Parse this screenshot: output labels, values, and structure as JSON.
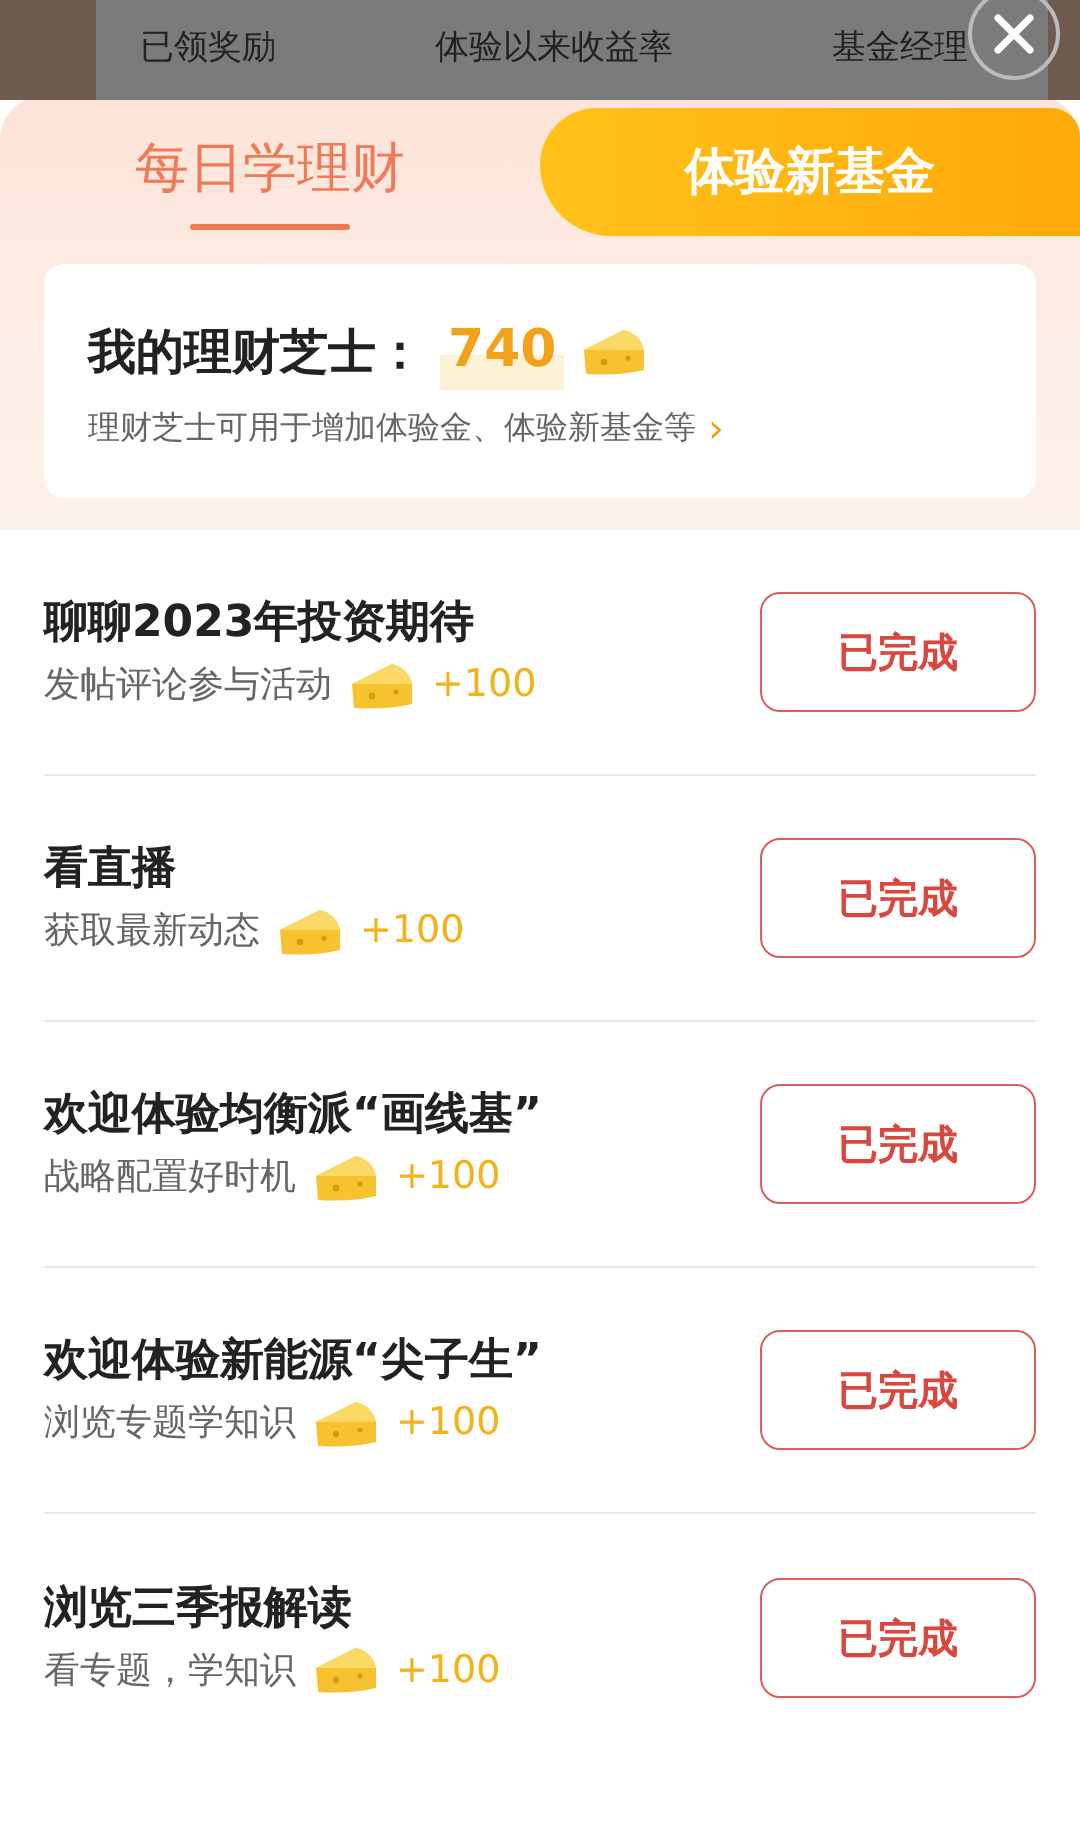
{
  "background_header": {
    "labels": [
      "已领奖励",
      "体验以来收益率",
      "基金经理"
    ]
  },
  "tabs": [
    {
      "label": "每日学理财",
      "selected": true
    },
    {
      "label": "体验新基金",
      "selected": false
    }
  ],
  "points_card": {
    "title": "我的理财芝士：",
    "points": "740",
    "description": "理财芝士可用于增加体验金、体验新基金等",
    "chevron": "›"
  },
  "tasks": [
    {
      "title": "聊聊2023年投资期待",
      "subtitle": "发帖评论参与活动",
      "reward": "+100",
      "button": "已完成"
    },
    {
      "title": "看直播",
      "subtitle": "获取最新动态",
      "reward": "+100",
      "button": "已完成"
    },
    {
      "title": "欢迎体验均衡派“画线基”",
      "subtitle": "战略配置好时机",
      "reward": "+100",
      "button": "已完成"
    },
    {
      "title": "欢迎体验新能源“尖子生”",
      "subtitle": "浏览专题学知识",
      "reward": "+100",
      "button": "已完成"
    },
    {
      "title": "浏览三季报解读",
      "subtitle": "看专题，学知识",
      "reward": "+100",
      "button": "已完成"
    }
  ]
}
